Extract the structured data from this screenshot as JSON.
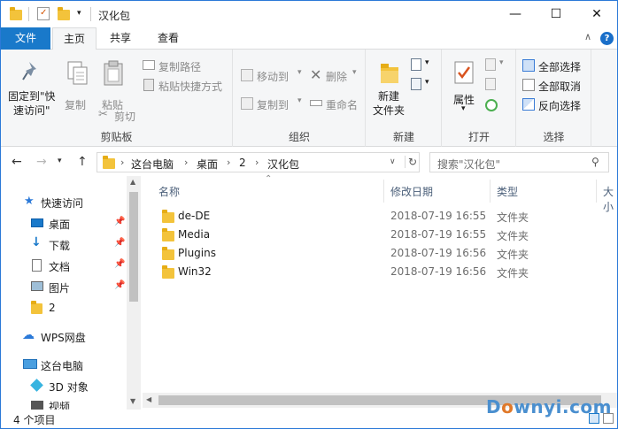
{
  "window": {
    "title": "汉化包",
    "minimize_symbol": "—",
    "maximize_symbol": "☐",
    "close_symbol": "✕"
  },
  "tabs": {
    "file": "文件",
    "home": "主页",
    "share": "共享",
    "view": "查看",
    "collapse_symbol": "∧",
    "help_symbol": "?"
  },
  "ribbon": {
    "clipboard": {
      "label": "剪贴板",
      "pin_line1": "固定到\"快",
      "pin_line2": "速访问\"",
      "copy": "复制",
      "paste": "粘贴",
      "cut": "剪切",
      "copy_path": "复制路径",
      "paste_shortcut": "粘贴快捷方式"
    },
    "organize": {
      "label": "组织",
      "move_to": "移动到",
      "copy_to": "复制到",
      "delete": "删除",
      "rename": "重命名"
    },
    "new": {
      "label": "新建",
      "new_folder_line1": "新建",
      "new_folder_line2": "文件夹"
    },
    "open": {
      "label": "打开",
      "properties": "属性"
    },
    "select": {
      "label": "选择",
      "select_all": "全部选择",
      "select_none": "全部取消",
      "invert": "反向选择"
    }
  },
  "address": {
    "crumbs": [
      "这台电脑",
      "桌面",
      "2",
      "汉化包"
    ],
    "search_placeholder": "搜索\"汉化包\""
  },
  "sidebar": {
    "items": [
      {
        "label": "快速访问"
      },
      {
        "label": "桌面"
      },
      {
        "label": "下载"
      },
      {
        "label": "文档"
      },
      {
        "label": "图片"
      },
      {
        "label": "2"
      },
      {
        "label": "WPS网盘"
      },
      {
        "label": "这台电脑"
      },
      {
        "label": "3D 对象"
      },
      {
        "label": "视频"
      }
    ]
  },
  "columns": {
    "name": "名称",
    "date": "修改日期",
    "type": "类型",
    "size": "大小"
  },
  "files": [
    {
      "name": "de-DE",
      "date": "2018-07-19 16:55",
      "type": "文件夹"
    },
    {
      "name": "Media",
      "date": "2018-07-19 16:55",
      "type": "文件夹"
    },
    {
      "name": "Plugins",
      "date": "2018-07-19 16:56",
      "type": "文件夹"
    },
    {
      "name": "Win32",
      "date": "2018-07-19 16:56",
      "type": "文件夹"
    }
  ],
  "status": {
    "count": "4 个项目"
  },
  "watermark": {
    "prefix": "D",
    "o": "o",
    "suffix": "wnyi.com"
  },
  "colors": {
    "accent": "#1979ca",
    "folder": "#f3c33b"
  }
}
